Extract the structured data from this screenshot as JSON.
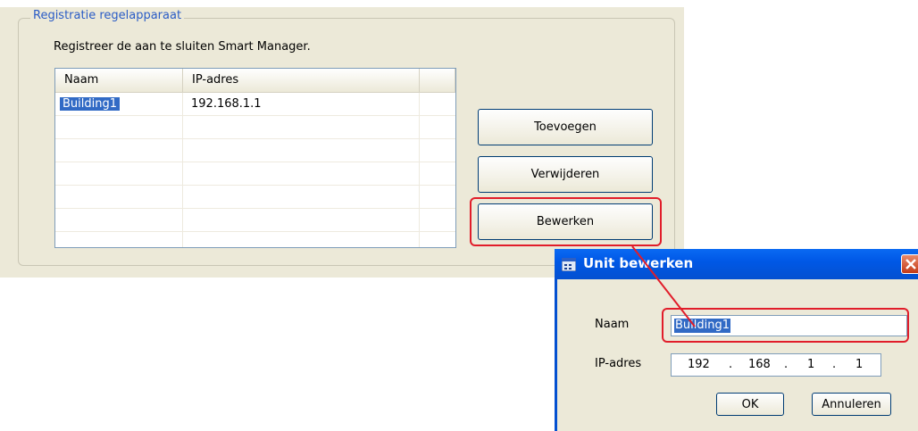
{
  "group": {
    "title": "Registratie regelapparaat",
    "instruction": "Registreer de aan te sluiten Smart Manager."
  },
  "list": {
    "columns": [
      "Naam",
      "IP-adres"
    ],
    "rows": [
      {
        "name": "Building1",
        "ip": "192.168.1.1"
      }
    ]
  },
  "buttons": {
    "add": "Toevoegen",
    "remove": "Verwijderen",
    "edit": "Bewerken"
  },
  "dialog": {
    "title": "Unit bewerken",
    "name_label": "Naam",
    "name_value": "Building1",
    "ip_label": "IP-adres",
    "ip_octets": [
      "192",
      "168",
      "1",
      "1"
    ],
    "ip_sep": ".",
    "ok": "OK",
    "cancel": "Annuleren"
  },
  "colors": {
    "highlight": "#e11d2a",
    "selection": "#316ac5",
    "titlebar": "#0058e6"
  }
}
